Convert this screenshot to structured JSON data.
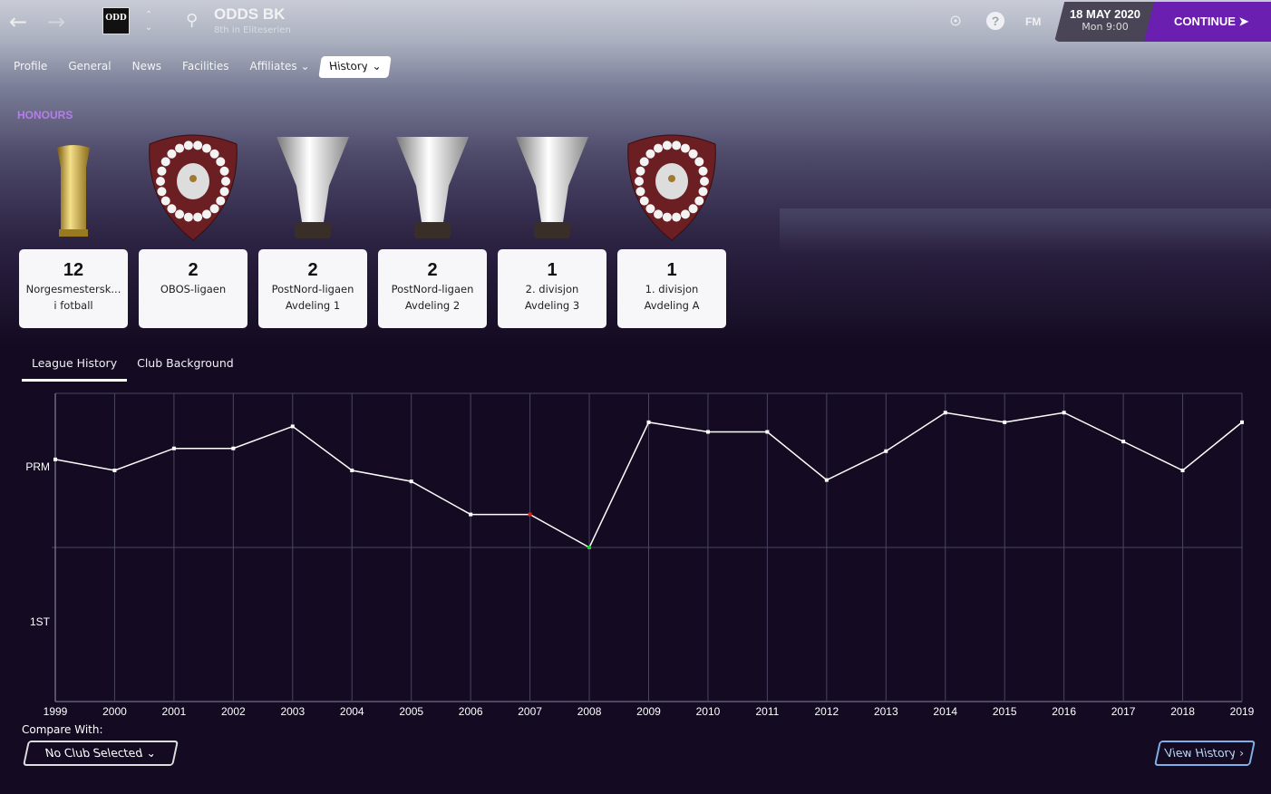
{
  "header": {
    "club_name": "ODDS BK",
    "club_status": "8th in Eliteserien",
    "crest_text": "ODD",
    "date": "18 MAY 2020",
    "time": "Mon 9:00",
    "continue_label": "CONTINUE",
    "fm_label": "FM"
  },
  "tabs": [
    {
      "label": "Profile"
    },
    {
      "label": "General"
    },
    {
      "label": "News"
    },
    {
      "label": "Facilities"
    },
    {
      "label": "Affiliates",
      "dropdown": true
    },
    {
      "label": "History",
      "dropdown": true,
      "selected": true
    }
  ],
  "honours": {
    "title": "HONOURS",
    "items": [
      {
        "count": "12",
        "line1": "Norgesmestersk...",
        "line2": "i fotball",
        "trophy": "gold-cup"
      },
      {
        "count": "2",
        "line1": "OBOS-ligaen",
        "line2": "",
        "trophy": "shield"
      },
      {
        "count": "2",
        "line1": "PostNord-ligaen",
        "line2": "Avdeling 1",
        "trophy": "silver-cup"
      },
      {
        "count": "2",
        "line1": "PostNord-ligaen",
        "line2": "Avdeling 2",
        "trophy": "silver-cup"
      },
      {
        "count": "1",
        "line1": "2. divisjon",
        "line2": "Avdeling 3",
        "trophy": "silver-cup"
      },
      {
        "count": "1",
        "line1": "1. divisjon",
        "line2": "Avdeling A",
        "trophy": "shield"
      }
    ]
  },
  "subtabs": [
    {
      "label": "League History",
      "selected": true
    },
    {
      "label": "Club Background"
    }
  ],
  "chart_data": {
    "type": "line",
    "title": "",
    "y_levels": [
      "PRM",
      "1ST"
    ],
    "x": [
      "1999",
      "2000",
      "2001",
      "2002",
      "2003",
      "2004",
      "2005",
      "2006",
      "2007",
      "2008",
      "2009",
      "2010",
      "2011",
      "2012",
      "2013",
      "2014",
      "2015",
      "2016",
      "2017",
      "2018",
      "2019"
    ],
    "points": [
      {
        "year": "1999",
        "level": "PRM",
        "position": 6,
        "teams": 14
      },
      {
        "year": "2000",
        "level": "PRM",
        "position": 7,
        "teams": 14
      },
      {
        "year": "2001",
        "level": "PRM",
        "position": 5,
        "teams": 14
      },
      {
        "year": "2002",
        "level": "PRM",
        "position": 5,
        "teams": 14
      },
      {
        "year": "2003",
        "level": "PRM",
        "position": 3,
        "teams": 14
      },
      {
        "year": "2004",
        "level": "PRM",
        "position": 7,
        "teams": 14
      },
      {
        "year": "2005",
        "level": "PRM",
        "position": 8,
        "teams": 14
      },
      {
        "year": "2006",
        "level": "PRM",
        "position": 11,
        "teams": 14
      },
      {
        "year": "2007",
        "level": "PRM",
        "position": 11,
        "teams": 14,
        "marker": "relegated"
      },
      {
        "year": "2008",
        "level": "1ST",
        "position": 1,
        "teams": 16,
        "marker": "promoted"
      },
      {
        "year": "2009",
        "level": "PRM",
        "position": 3,
        "teams": 16
      },
      {
        "year": "2010",
        "level": "PRM",
        "position": 4,
        "teams": 16
      },
      {
        "year": "2011",
        "level": "PRM",
        "position": 4,
        "teams": 16
      },
      {
        "year": "2012",
        "level": "PRM",
        "position": 9,
        "teams": 16
      },
      {
        "year": "2013",
        "level": "PRM",
        "position": 6,
        "teams": 16
      },
      {
        "year": "2014",
        "level": "PRM",
        "position": 2,
        "teams": 16
      },
      {
        "year": "2015",
        "level": "PRM",
        "position": 3,
        "teams": 16
      },
      {
        "year": "2016",
        "level": "PRM",
        "position": 2,
        "teams": 16
      },
      {
        "year": "2017",
        "level": "PRM",
        "position": 5,
        "teams": 16
      },
      {
        "year": "2018",
        "level": "PRM",
        "position": 8,
        "teams": 16
      },
      {
        "year": "2019",
        "level": "PRM",
        "position": 3,
        "teams": 16
      }
    ],
    "colors": {
      "line": "#ffffff",
      "relegated": "#e0201a",
      "promoted": "#22cc33",
      "grid": "#4a4560"
    }
  },
  "compare": {
    "label": "Compare With:",
    "selected": "No Club Selected"
  },
  "view_history_label": "View History",
  "colors": {
    "accent": "#6a1fb0",
    "honours": "#b57ee8",
    "background": "#140b22",
    "view_history": "#7fb0e8"
  }
}
